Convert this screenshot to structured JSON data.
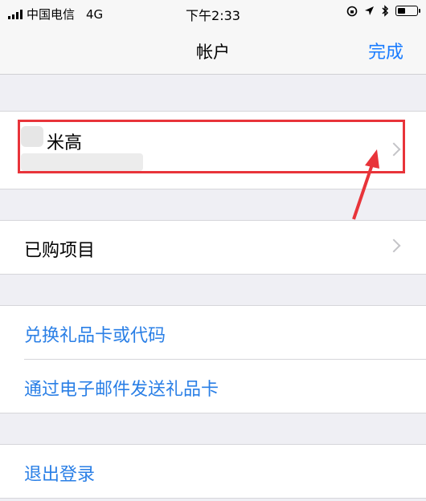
{
  "status_bar": {
    "carrier": "中国电信",
    "network": "4G",
    "time": "下午2:33"
  },
  "nav": {
    "title": "帐户",
    "done": "完成"
  },
  "account": {
    "name": "米高"
  },
  "rows": {
    "purchased": "已购项目",
    "redeem": "兑换礼品卡或代码",
    "send_gift": "通过电子邮件发送礼品卡",
    "sign_out": "退出登录"
  },
  "colors": {
    "accent": "#1a7cff",
    "annotation": "#e8343a"
  }
}
